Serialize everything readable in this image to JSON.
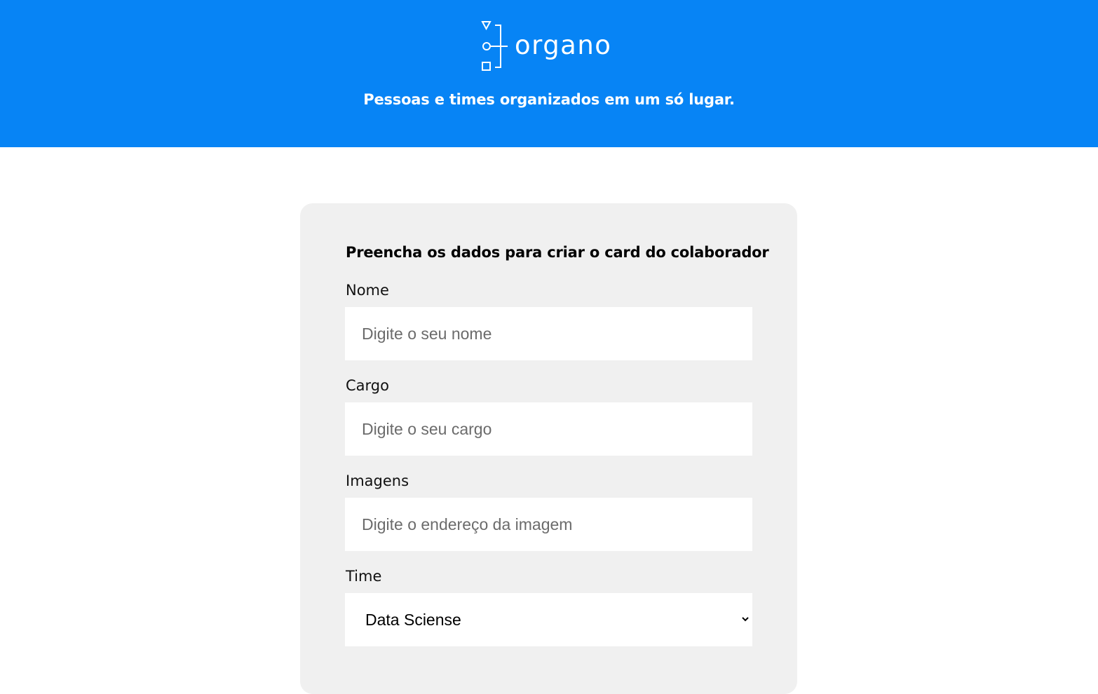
{
  "header": {
    "brand": "organo",
    "tagline": "Pessoas e times organizados em um só lugar.",
    "background_color": "#0784f5",
    "logo_icon": "org-chart-icon"
  },
  "form": {
    "title": "Preencha os dados para criar o card do colaborador",
    "card_background": "#f0f0f0",
    "fields": {
      "nome": {
        "label": "Nome",
        "placeholder": "Digite o seu nome",
        "value": ""
      },
      "cargo": {
        "label": "Cargo",
        "placeholder": "Digite o seu cargo",
        "value": ""
      },
      "imagem": {
        "label": "Imagens",
        "placeholder": "Digite o endereço da imagem",
        "value": ""
      },
      "time": {
        "label": "Time",
        "selected": "Data Sciense",
        "icon": "chevron-down-icon"
      }
    }
  }
}
